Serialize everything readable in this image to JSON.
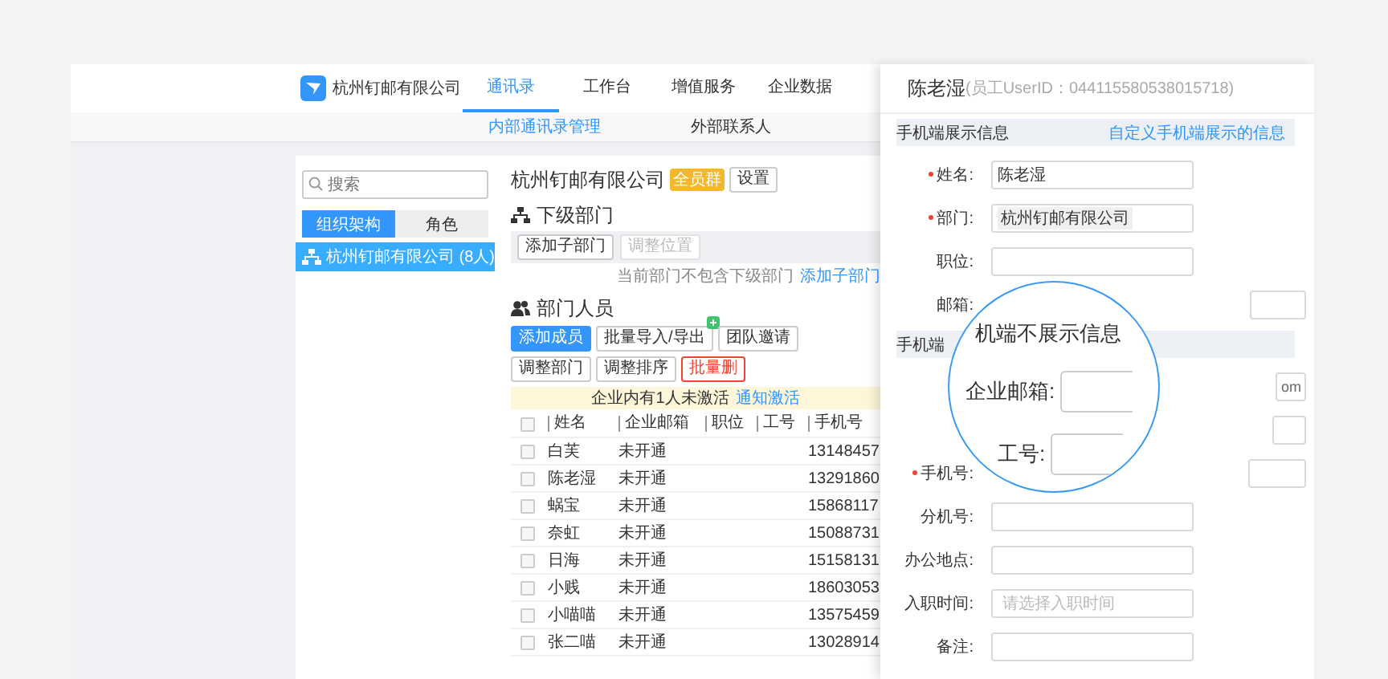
{
  "header": {
    "company": "杭州钉邮有限公司",
    "nav": [
      {
        "label": "通讯录",
        "selected": true
      },
      {
        "label": "工作台",
        "selected": false
      },
      {
        "label": "增值服务",
        "selected": false
      },
      {
        "label": "企业数据",
        "selected": false
      }
    ]
  },
  "subnav": [
    {
      "label": "内部通讯录管理",
      "selected": true
    },
    {
      "label": "外部联系人",
      "selected": false
    }
  ],
  "sidebar": {
    "search_placeholder": "搜索",
    "tabs": [
      {
        "label": "组织架构",
        "selected": true
      },
      {
        "label": "角色",
        "selected": false
      }
    ],
    "tree": [
      {
        "label": "杭州钉邮有限公司 (8人)",
        "selected": true
      }
    ]
  },
  "main": {
    "title": "杭州钉邮有限公司",
    "badge": "全员群",
    "settings_button": "设置",
    "subdept": {
      "heading": "下级部门",
      "buttons": [
        {
          "label": "添加子部门",
          "disabled": false
        },
        {
          "label": "调整位置",
          "disabled": true
        }
      ],
      "note": "当前部门不包含下级部门",
      "note_link": "添加子部门"
    },
    "members": {
      "heading": "部门人员",
      "buttons": [
        {
          "label": "添加成员",
          "kind": "primary"
        },
        {
          "label": "批量导入/导出",
          "kind": "new"
        },
        {
          "label": "团队邀请",
          "kind": "normal"
        },
        {
          "label": "调整部门",
          "kind": "normal"
        },
        {
          "label": "调整排序",
          "kind": "normal"
        },
        {
          "label": "批量删",
          "kind": "danger"
        }
      ],
      "notice": "企业内有1人未激活",
      "notice_link": "通知激活",
      "header_checked": false,
      "columns": [
        "姓名",
        "企业邮箱",
        "职位",
        "工号",
        "手机号"
      ],
      "rows": [
        {
          "checked": false,
          "name": "白芙",
          "email": "未开通",
          "phone": "13148457"
        },
        {
          "checked": false,
          "name": "陈老湿",
          "email": "未开通",
          "phone": "13291860"
        },
        {
          "checked": false,
          "name": "蜗宝",
          "email": "未开通",
          "phone": "15868117"
        },
        {
          "checked": false,
          "name": "奈虹",
          "email": "未开通",
          "phone": "15088731"
        },
        {
          "checked": false,
          "name": "日海",
          "email": "未开通",
          "phone": "15158131"
        },
        {
          "checked": false,
          "name": "小贱",
          "email": "未开通",
          "phone": "18603053"
        },
        {
          "checked": false,
          "name": "小喵喵",
          "email": "未开通",
          "phone": "13575459"
        },
        {
          "checked": false,
          "name": "张二喵",
          "email": "未开通",
          "phone": "13028914"
        }
      ]
    }
  },
  "drawer": {
    "name": "陈老湿",
    "user_id": "(员工UserID：044115580538015718)",
    "sections": [
      {
        "title": "手机端展示信息",
        "link": "自定义手机端展示的信息",
        "fields": [
          {
            "kind": "text",
            "label": "姓名:",
            "required": true,
            "value": "陈老湿"
          },
          {
            "kind": "tags",
            "label": "部门:",
            "required": true,
            "tag": "杭州钉邮有限公司"
          },
          {
            "kind": "text",
            "label": "职位:",
            "required": false
          },
          {
            "kind": "text",
            "label": "邮箱:",
            "required": false
          }
        ]
      },
      {
        "title": "手机端",
        "fields": [
          {
            "kind": "text",
            "suffix": "om"
          },
          {
            "kind": "text"
          },
          {
            "kind": "text",
            "label": "手机号:",
            "required": true
          },
          {
            "kind": "text",
            "label": "分机号:",
            "required": false
          },
          {
            "kind": "text",
            "label": "办公地点:",
            "required": false
          },
          {
            "kind": "date",
            "label": "入职时间:",
            "required": false,
            "placeholder": "请选择入职时间"
          },
          {
            "kind": "text",
            "label": "备注:",
            "required": false
          }
        ]
      }
    ],
    "magnifier": {
      "heading": "机端不展示信息",
      "fields": [
        {
          "label": "企业邮箱:"
        },
        {
          "label": "工号:"
        }
      ]
    }
  }
}
